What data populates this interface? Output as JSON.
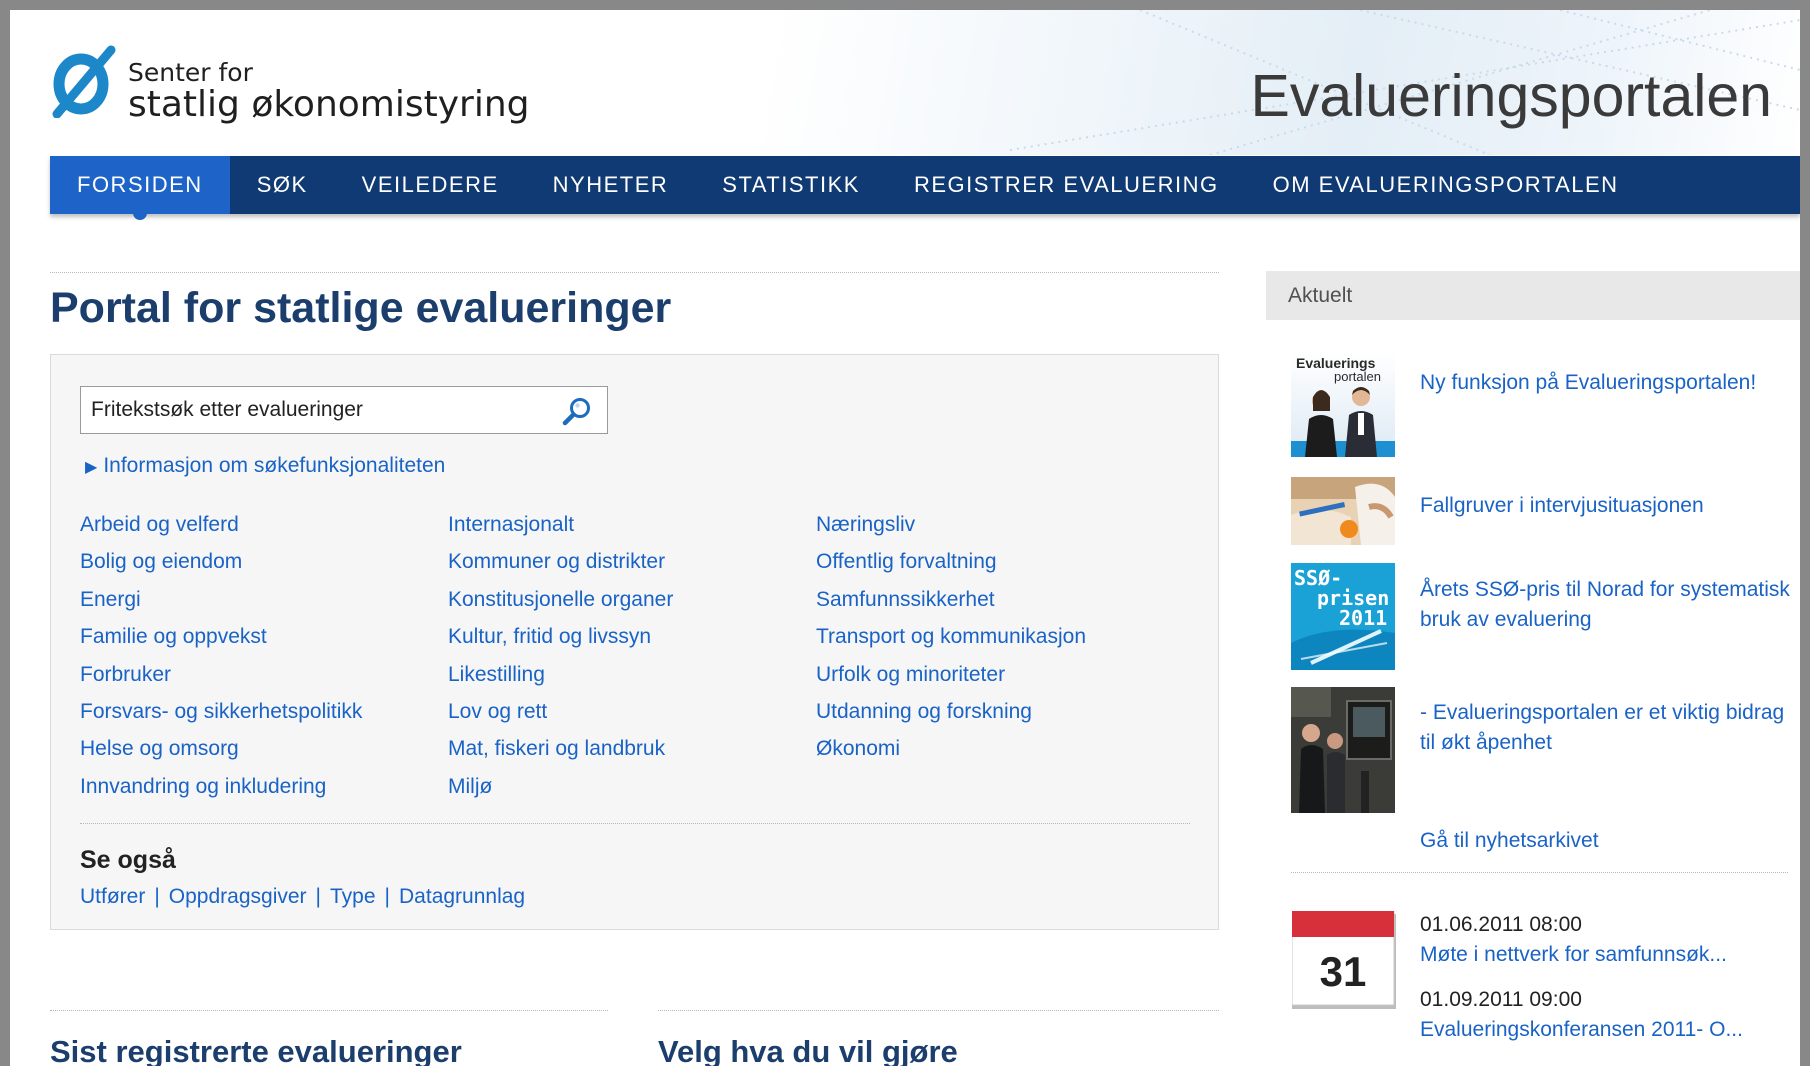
{
  "header": {
    "logo_line1": "Senter for",
    "logo_line2": "statlig økonomistyring",
    "portal_name": "Evalueringsportalen"
  },
  "nav": {
    "items": [
      {
        "label": "FORSIDEN",
        "active": true
      },
      {
        "label": "SØK"
      },
      {
        "label": "VEILEDERE"
      },
      {
        "label": "NYHETER"
      },
      {
        "label": "STATISTIKK"
      },
      {
        "label": "REGISTRER EVALUERING"
      },
      {
        "label": "OM EVALUERINGSPORTALEN"
      }
    ]
  },
  "main": {
    "title": "Portal for statlige evalueringer",
    "search": {
      "placeholder": "Fritekstsøk etter evalueringer",
      "icon": "magnifier-icon"
    },
    "info_link": "Informasjon om søkefunksjonaliteten",
    "topics": [
      [
        "Arbeid og velferd",
        "Bolig og eiendom",
        "Energi",
        "Familie og oppvekst",
        "Forbruker",
        "Forsvars- og sikkerhetspolitikk",
        "Helse og omsorg",
        "Innvandring og inkludering"
      ],
      [
        "Internasjonalt",
        "Kommuner og distrikter",
        "Konstitusjonelle organer",
        "Kultur, fritid og livssyn",
        "Likestilling",
        "Lov og rett",
        "Mat, fiskeri og landbruk",
        "Miljø"
      ],
      [
        "Næringsliv",
        "Offentlig forvaltning",
        "Samfunnssikkerhet",
        "Transport og kommunikasjon",
        "Urfolk og minoriteter",
        "Utdanning og forskning",
        "Økonomi"
      ]
    ],
    "see_also": {
      "title": "Se også",
      "links": [
        "Utfører",
        "Oppdragsgiver",
        "Type",
        "Datagrunnlag"
      ],
      "separator": "|"
    },
    "bottom_sections": [
      "Sist registrerte evalueringer",
      "Velg hva du vil gjøre"
    ]
  },
  "sidebar": {
    "title": "Aktuelt",
    "news": [
      {
        "title": "Ny funksjon på Evalueringsportalen!",
        "thumb_text": [
          "Evaluerings",
          "portalen"
        ]
      },
      {
        "title": "Fallgruver i intervjusituasjonen"
      },
      {
        "title": "Årets SSØ-pris til Norad for systematisk bruk av evaluering",
        "thumb_text": [
          "SSØ-",
          "prisen",
          "2011"
        ]
      },
      {
        "title": "- Evalueringsportalen er et viktig bidrag til økt åpenhet"
      }
    ],
    "archive_link": "Gå til nyhetsarkivet",
    "calendar_day": "31",
    "events": [
      {
        "date": "01.06.2011 08:00",
        "title": "Møte i nettverk for samfunnsøk..."
      },
      {
        "date": "01.09.2011 09:00",
        "title": "Evalueringskonferansen 2011- O..."
      }
    ]
  },
  "colors": {
    "nav_bg": "#103a73",
    "nav_active": "#1d63c8",
    "link": "#1a63c6",
    "heading": "#1b3e6d",
    "logo_blue": "#1c87c9"
  }
}
